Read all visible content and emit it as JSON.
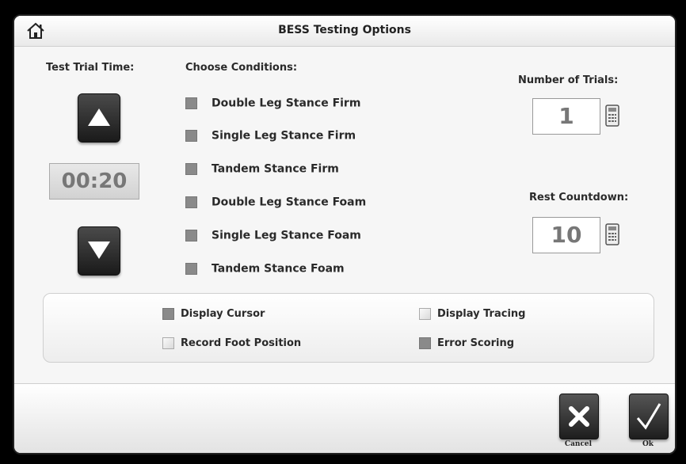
{
  "window": {
    "title": "BESS Testing Options",
    "home_icon": "home-icon"
  },
  "trial_time": {
    "label": "Test Trial Time:",
    "value": "00:20",
    "up_icon": "arrow-up-icon",
    "down_icon": "arrow-down-icon"
  },
  "conditions": {
    "label": "Choose Conditions:",
    "items": [
      {
        "label": "Double Leg Stance Firm",
        "checked": true
      },
      {
        "label": "Single Leg Stance Firm",
        "checked": true
      },
      {
        "label": "Tandem Stance Firm",
        "checked": true
      },
      {
        "label": "Double Leg Stance Foam",
        "checked": true
      },
      {
        "label": "Single Leg Stance Foam",
        "checked": true
      },
      {
        "label": "Tandem Stance Foam",
        "checked": true
      }
    ]
  },
  "trials": {
    "label": "Number of Trials:",
    "value": "1",
    "icon": "calculator-icon"
  },
  "rest": {
    "label": "Rest Countdown:",
    "value": "10",
    "icon": "calculator-icon"
  },
  "options": {
    "display_cursor": {
      "label": "Display Cursor",
      "checked": true
    },
    "display_tracing": {
      "label": "Display Tracing",
      "checked": false
    },
    "record_foot_position": {
      "label": "Record Foot Position",
      "checked": false
    },
    "error_scoring": {
      "label": "Error Scoring",
      "checked": true
    }
  },
  "footer": {
    "cancel_label": "Cancel",
    "cancel_icon": "x-icon",
    "ok_label": "Ok",
    "ok_icon": "checkmark-icon"
  }
}
